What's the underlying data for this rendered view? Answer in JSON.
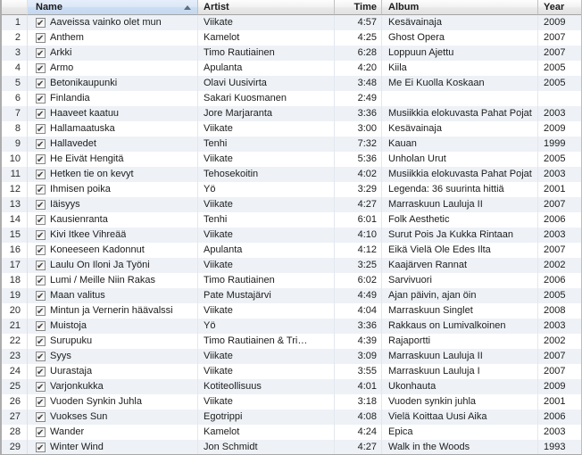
{
  "app": {
    "description": "music-library track list"
  },
  "icons": {
    "sort_ascending": "triangle-up",
    "checkbox_checked": "check-mark"
  },
  "colors": {
    "row_stripe": "#eef2f7",
    "row_white": "#ffffff",
    "sorted_header_tint_top": "#e6eefa",
    "sorted_header_tint_bottom": "#c5d8f0",
    "header_gray_top": "#fdfdfd",
    "header_gray_bottom": "#e2e2e2",
    "body_separator": "#e3e8ee",
    "header_separator": "#c2c2c2",
    "sort_arrow": "#5c6e80"
  },
  "table": {
    "sort": {
      "column": "Name",
      "direction": "ascending"
    },
    "columns": [
      {
        "key": "num",
        "label": ""
      },
      {
        "key": "name",
        "label": "Name"
      },
      {
        "key": "artist",
        "label": "Artist"
      },
      {
        "key": "time",
        "label": "Time"
      },
      {
        "key": "album",
        "label": "Album"
      },
      {
        "key": "year",
        "label": "Year"
      }
    ],
    "rows": [
      {
        "num": 1,
        "checked": true,
        "name": "Aaveissa vainko olet mun",
        "artist": "Viikate",
        "time": "4:57",
        "album": "Kesävainaja",
        "year": "2009"
      },
      {
        "num": 2,
        "checked": true,
        "name": "Anthem",
        "artist": "Kamelot",
        "time": "4:25",
        "album": "Ghost Opera",
        "year": "2007"
      },
      {
        "num": 3,
        "checked": true,
        "name": "Arkki",
        "artist": "Timo Rautiainen",
        "time": "6:28",
        "album": "Loppuun Ajettu",
        "year": "2007"
      },
      {
        "num": 4,
        "checked": true,
        "name": "Armo",
        "artist": "Apulanta",
        "time": "4:20",
        "album": "Kiila",
        "year": "2005"
      },
      {
        "num": 5,
        "checked": true,
        "name": "Betonikaupunki",
        "artist": "Olavi Uusivirta",
        "time": "3:48",
        "album": "Me Ei Kuolla Koskaan",
        "year": "2005"
      },
      {
        "num": 6,
        "checked": true,
        "name": "Finlandia",
        "artist": "Sakari Kuosmanen",
        "time": "2:49",
        "album": "",
        "year": ""
      },
      {
        "num": 7,
        "checked": true,
        "name": "Haaveet kaatuu",
        "artist": "Jore Marjaranta",
        "time": "3:36",
        "album": "Musiikkia elokuvasta Pahat Pojat",
        "year": "2003"
      },
      {
        "num": 8,
        "checked": true,
        "name": "Hallamaatuska",
        "artist": "Viikate",
        "time": "3:00",
        "album": "Kesävainaja",
        "year": "2009"
      },
      {
        "num": 9,
        "checked": true,
        "name": "Hallavedet",
        "artist": "Tenhi",
        "time": "7:32",
        "album": "Kauan",
        "year": "1999"
      },
      {
        "num": 10,
        "checked": true,
        "name": "He Eivät Hengitä",
        "artist": "Viikate",
        "time": "5:36",
        "album": "Unholan Urut",
        "year": "2005"
      },
      {
        "num": 11,
        "checked": true,
        "name": "Hetken tie on kevyt",
        "artist": "Tehosekoitin",
        "time": "4:02",
        "album": "Musiikkia elokuvasta Pahat Pojat",
        "year": "2003"
      },
      {
        "num": 12,
        "checked": true,
        "name": "Ihmisen poika",
        "artist": "Yö",
        "time": "3:29",
        "album": "Legenda: 36 suurinta hittiä",
        "year": "2001"
      },
      {
        "num": 13,
        "checked": true,
        "name": "Iäisyys",
        "artist": "Viikate",
        "time": "4:27",
        "album": "Marraskuun Lauluja II",
        "year": "2007"
      },
      {
        "num": 14,
        "checked": true,
        "name": "Kausienranta",
        "artist": "Tenhi",
        "time": "6:01",
        "album": "Folk Aesthetic",
        "year": "2006"
      },
      {
        "num": 15,
        "checked": true,
        "name": "Kivi Itkee Vihreää",
        "artist": "Viikate",
        "time": "4:10",
        "album": "Surut Pois Ja Kukka Rintaan",
        "year": "2003"
      },
      {
        "num": 16,
        "checked": true,
        "name": "Koneeseen Kadonnut",
        "artist": "Apulanta",
        "time": "4:12",
        "album": "Eikä Vielä Ole Edes Ilta",
        "year": "2007"
      },
      {
        "num": 17,
        "checked": true,
        "name": "Laulu On Iloni Ja Työni",
        "artist": "Viikate",
        "time": "3:25",
        "album": "Kaajärven Rannat",
        "year": "2002"
      },
      {
        "num": 18,
        "checked": true,
        "name": "Lumi / Meille Niin Rakas",
        "artist": "Timo Rautiainen",
        "time": "6:02",
        "album": "Sarvivuori",
        "year": "2006"
      },
      {
        "num": 19,
        "checked": true,
        "name": "Maan valitus",
        "artist": "Pate Mustajärvi",
        "time": "4:49",
        "album": "Ajan päivin, ajan öin",
        "year": "2005"
      },
      {
        "num": 20,
        "checked": true,
        "name": "Mintun ja Vernerin häävalssi",
        "artist": "Viikate",
        "time": "4:04",
        "album": "Marraskuun Singlet",
        "year": "2008"
      },
      {
        "num": 21,
        "checked": true,
        "name": "Muistoja",
        "artist": "Yö",
        "time": "3:36",
        "album": "Rakkaus on Lumivalkoinen",
        "year": "2003"
      },
      {
        "num": 22,
        "checked": true,
        "name": "Surupuku",
        "artist": "Timo Rautiainen & Tri…",
        "time": "4:39",
        "album": "Rajaportti",
        "year": "2002"
      },
      {
        "num": 23,
        "checked": true,
        "name": "Syys",
        "artist": "Viikate",
        "time": "3:09",
        "album": "Marraskuun Lauluja II",
        "year": "2007"
      },
      {
        "num": 24,
        "checked": true,
        "name": "Uurastaja",
        "artist": "Viikate",
        "time": "3:55",
        "album": "Marraskuun Lauluja I",
        "year": "2007"
      },
      {
        "num": 25,
        "checked": true,
        "name": "Varjonkukka",
        "artist": "Kotiteollisuus",
        "time": "4:01",
        "album": "Ukonhauta",
        "year": "2009"
      },
      {
        "num": 26,
        "checked": true,
        "name": "Vuoden Synkin Juhla",
        "artist": "Viikate",
        "time": "3:18",
        "album": "Vuoden synkin juhla",
        "year": "2001"
      },
      {
        "num": 27,
        "checked": true,
        "name": "Vuokses Sun",
        "artist": "Egotrippi",
        "time": "4:08",
        "album": "Vielä Koittaa Uusi Aika",
        "year": "2006"
      },
      {
        "num": 28,
        "checked": true,
        "name": "Wander",
        "artist": "Kamelot",
        "time": "4:24",
        "album": "Epica",
        "year": "2003"
      },
      {
        "num": 29,
        "checked": true,
        "name": "Winter Wind",
        "artist": "Jon Schmidt",
        "time": "4:27",
        "album": "Walk in the Woods",
        "year": "1993"
      }
    ]
  }
}
